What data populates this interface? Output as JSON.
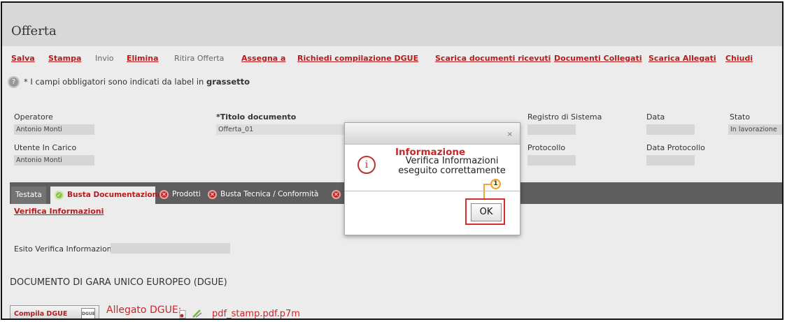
{
  "window": {
    "title": "Offerta"
  },
  "toolbar": [
    {
      "label": "Salva",
      "enabled": true
    },
    {
      "label": "Stampa",
      "enabled": true
    },
    {
      "label": "Invio",
      "enabled": false
    },
    {
      "label": "Elimina",
      "enabled": true
    },
    {
      "label": "Ritira Offerta",
      "enabled": false
    },
    {
      "label": "Assegna a",
      "enabled": true
    },
    {
      "label": "Richiedi compilazione DGUE",
      "enabled": true
    },
    {
      "label": "Scarica documenti ricevuti",
      "enabled": true
    },
    {
      "label": "Documenti Collegati",
      "enabled": true
    },
    {
      "label": "Scarica Allegati",
      "enabled": true
    },
    {
      "label": "Chiudi",
      "enabled": true
    }
  ],
  "notice": {
    "prefix": "* I campi obbligatori sono indicati da label in ",
    "bold": "grassetto"
  },
  "form": {
    "operatore_label": "Operatore",
    "operatore_value": "Antonio Monti",
    "utente_label": "Utente In Carico",
    "utente_value": "Antonio Monti",
    "titolo_label": "*Titolo documento",
    "titolo_value": "Offerta_01",
    "registro_label": "Registro di Sistema",
    "registro_value": "",
    "data_label": "Data",
    "data_value": "",
    "stato_label": "Stato",
    "stato_value": "In lavorazione",
    "protocollo_label": "Protocollo",
    "protocollo_value": "",
    "data_protocollo_label": "Data Protocollo",
    "data_protocollo_value": ""
  },
  "tabs": [
    {
      "label": "Testata",
      "status": "none"
    },
    {
      "label": "Busta Documentazione",
      "status": "ok"
    },
    {
      "label": "Prodotti",
      "status": "error"
    },
    {
      "label": "Busta Tecnica / Conformità",
      "status": "error"
    },
    {
      "label": "",
      "status": "error"
    }
  ],
  "content": {
    "verify_link": "Verifica Informazioni",
    "esito_label": "Esito Verifica Informazioni",
    "esito_value": "",
    "section_title": "DOCUMENTO DI GARA UNICO EUROPEO (DGUE)",
    "compila_button": "Compila DGUE",
    "pen_icon_text": "DGUE",
    "allegato_label": "Allegato DGUE:",
    "filename": "pdf_stamp.pdf.p7m"
  },
  "modal": {
    "close_symbol": "×",
    "title": "Informazione",
    "message_line1": "Verifica Informazioni",
    "message_line2": "eseguito correttamente",
    "ok_label": "OK",
    "callout_number": "1"
  },
  "colors": {
    "link_red": "#b71c1c",
    "tab_bar": "#5e5e5e",
    "highlight": "#d32f2f",
    "callout": "#f0a030"
  }
}
